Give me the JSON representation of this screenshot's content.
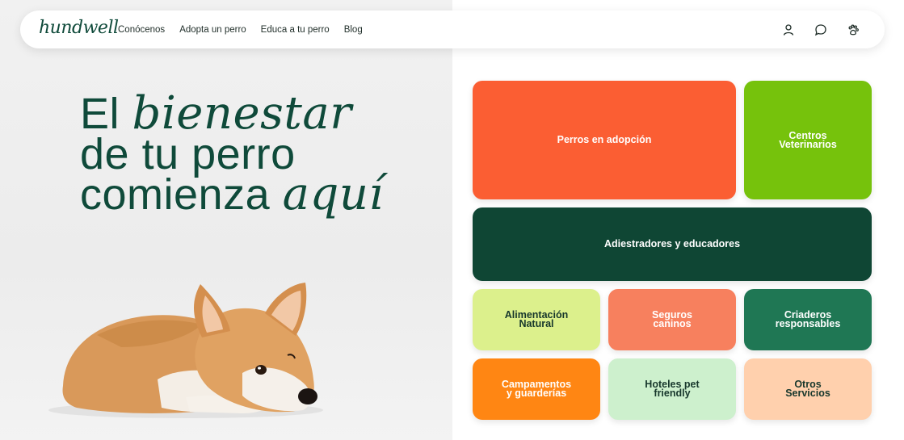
{
  "nav": {
    "logo": "hundwell",
    "links": [
      "Conócenos",
      "Adopta un perro",
      "Educa a tu perro",
      "Blog"
    ],
    "icons": [
      "user-icon",
      "chat-icon",
      "paw-icon"
    ]
  },
  "hero": {
    "line1_plain": "El ",
    "line1_em": "bienestar",
    "line2": "de tu perro",
    "line3_plain": "comienza ",
    "line3_em": "aquí"
  },
  "tiles": [
    {
      "lines": [
        "Perros en adopción"
      ],
      "color": "#fb5e33",
      "text_color": "#ffffff"
    },
    {
      "lines": [
        "Centros",
        "Veterinarios"
      ],
      "color": "#76c20c",
      "text_color": "#ffffff"
    },
    {
      "lines": [
        "Adiestradores y educadores"
      ],
      "color": "#0f4634",
      "text_color": "#ffffff"
    },
    {
      "lines": [
        "Alimentación",
        "Natural"
      ],
      "color": "#dcf08c",
      "text_color": "#17372c"
    },
    {
      "lines": [
        "Seguros",
        "caninos"
      ],
      "color": "#f7805e",
      "text_color": "#ffffff"
    },
    {
      "lines": [
        "Criaderos",
        "responsables"
      ],
      "color": "#1f7754",
      "text_color": "#ffffff"
    },
    {
      "lines": [
        "Campamentos",
        "y guarderías"
      ],
      "color": "#ff8613",
      "text_color": "#ffffff"
    },
    {
      "lines": [
        "Hoteles pet",
        "friendly"
      ],
      "color": "#cdf0cd",
      "text_color": "#17372c"
    },
    {
      "lines": [
        "Otros",
        "Servicios"
      ],
      "color": "#ffd0ad",
      "text_color": "#17372c"
    }
  ],
  "colors": {
    "brand": "#0f4a3a"
  }
}
